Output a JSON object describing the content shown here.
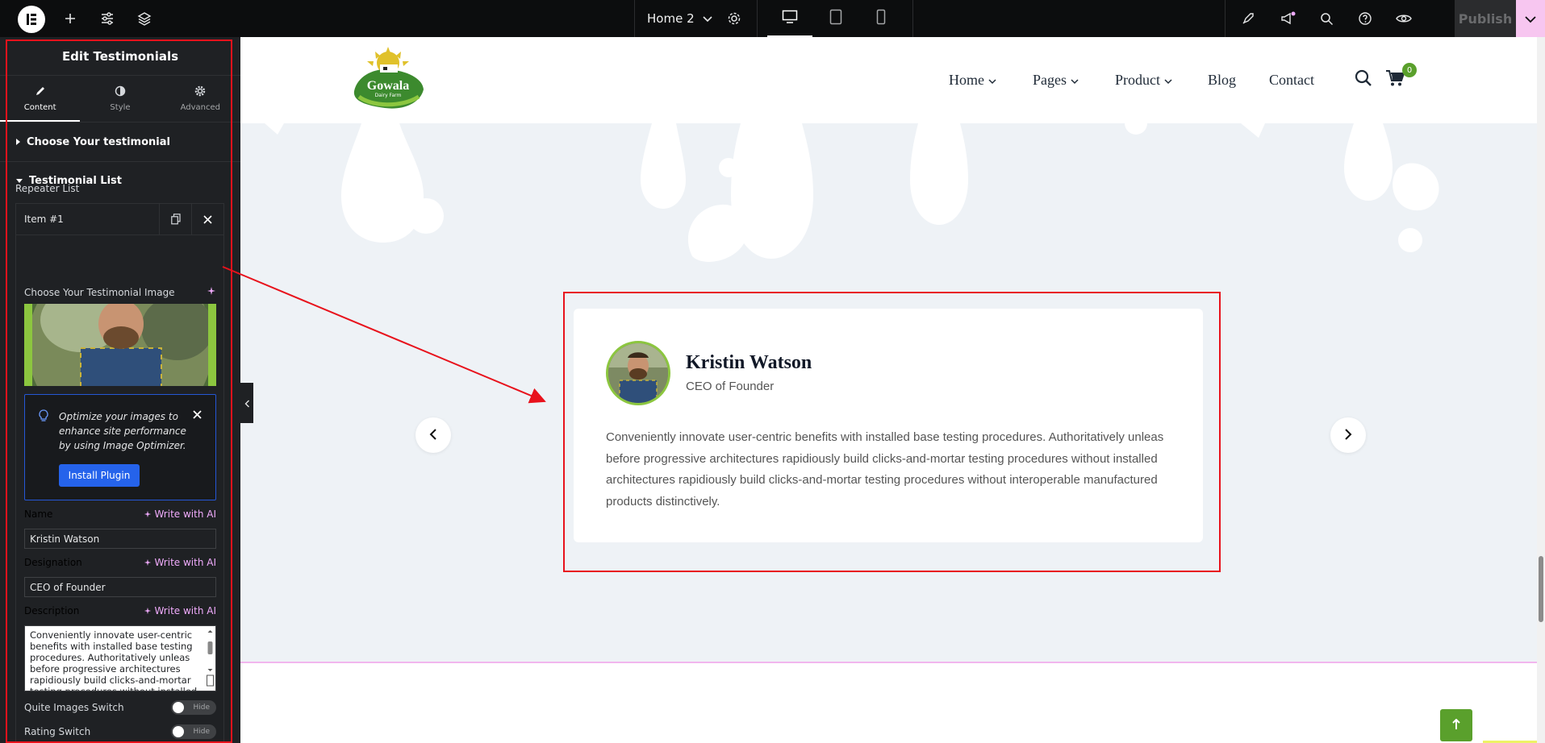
{
  "topbar": {
    "page_name": "Home 2",
    "publish_label": "Publish",
    "icons": [
      "elementor-logo-icon",
      "plus-icon",
      "sliders-icon",
      "layers-icon",
      "chevron-down-icon",
      "gear-icon",
      "desktop-icon",
      "tablet-icon",
      "mobile-icon",
      "rocket-icon",
      "megaphone-icon",
      "search-icon",
      "help-icon",
      "eye-icon",
      "chevron-down-icon"
    ]
  },
  "panel": {
    "title": "Edit Testimonials",
    "tabs": [
      {
        "label": "Content",
        "icon": "pencil-icon"
      },
      {
        "label": "Style",
        "icon": "half-circle-icon"
      },
      {
        "label": "Advanced",
        "icon": "gear-icon"
      }
    ],
    "sections": {
      "choose": "Choose Your testimonial",
      "list": "Testimonial List"
    },
    "repeater_label": "Repeater List",
    "item_title": "Item #1",
    "image_label": "Choose Your Testimonial Image",
    "notice_text": "Optimize your images to enhance site performance by using Image Optimizer.",
    "install_label": "Install Plugin",
    "ai_label": "Write with AI",
    "fields": {
      "name_label": "Name",
      "name_value": "Kristin Watson",
      "designation_label": "Designation",
      "designation_value": "CEO of Founder",
      "description_label": "Description",
      "description_value": "Conveniently innovate user-centric benefits with installed base testing procedures. Authoritatively unleas before progressive architectures rapidiously build clicks-and-mortar testing procedures without installed"
    },
    "switches": [
      {
        "label": "Quite Images Switch",
        "state": "Hide"
      },
      {
        "label": "Rating Switch",
        "state": "Hide"
      }
    ]
  },
  "site": {
    "logo_text": "Gowala",
    "logo_sub": "Dairy Farm",
    "nav": [
      {
        "label": "Home",
        "dropdown": true
      },
      {
        "label": "Pages",
        "dropdown": true
      },
      {
        "label": "Product",
        "dropdown": true
      },
      {
        "label": "Blog",
        "dropdown": false
      },
      {
        "label": "Contact",
        "dropdown": false
      }
    ],
    "cart_count": "0"
  },
  "testimonial": {
    "name": "Kristin Watson",
    "role": "CEO of Founder",
    "text": "Conveniently innovate user-centric benefits with installed base testing procedures. Authoritatively unleas before progressive architectures rapidiously build clicks-and-mortar testing procedures without installed architectures rapidiously build clicks-and-mortar testing procedures without interoperable manufactured products distinctively."
  },
  "colors": {
    "brand_green": "#5aa02c",
    "annotation_red": "#e8121c",
    "accent_pink": "#f0abfc",
    "editor_dark": "#1f2124"
  }
}
